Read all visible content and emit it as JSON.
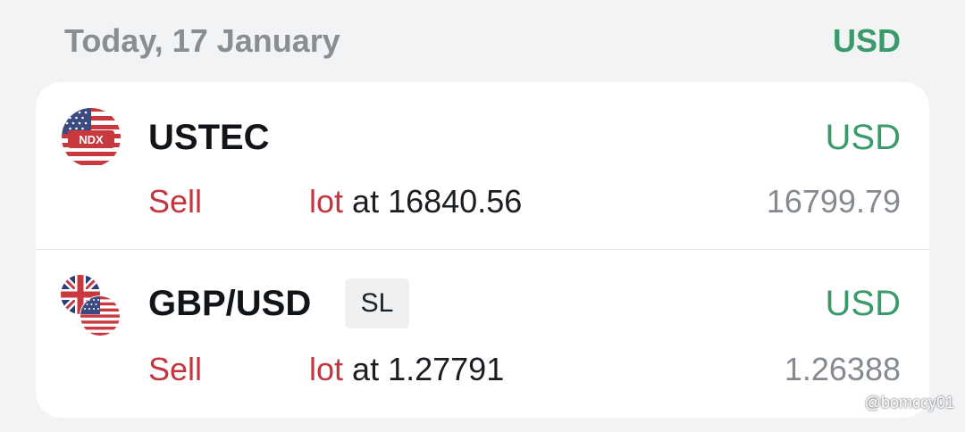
{
  "header": {
    "date_label": "Today, 17 January",
    "currency": "USD"
  },
  "positions": [
    {
      "symbol": "USTEC",
      "flag_label": "NDX",
      "currency": "USD",
      "side": "Sell",
      "lot_label": "lot",
      "at_label": "at",
      "open_price": "16840.56",
      "current_price": "16799.79"
    },
    {
      "symbol": "GBP/USD",
      "badge": "SL",
      "currency": "USD",
      "side": "Sell",
      "lot_label": "lot",
      "at_label": "at",
      "open_price": "1.27791",
      "current_price": "1.26388"
    }
  ],
  "watermark": "@bomccy01",
  "colors": {
    "accent_green": "#3a9a6a",
    "sell_red": "#c4353f",
    "muted_gray": "#8a8d91",
    "background": "#f2f3f5"
  },
  "icons": {
    "row1": "us-flag-ndx-icon",
    "row2": "gbp-usd-flags-icon"
  }
}
